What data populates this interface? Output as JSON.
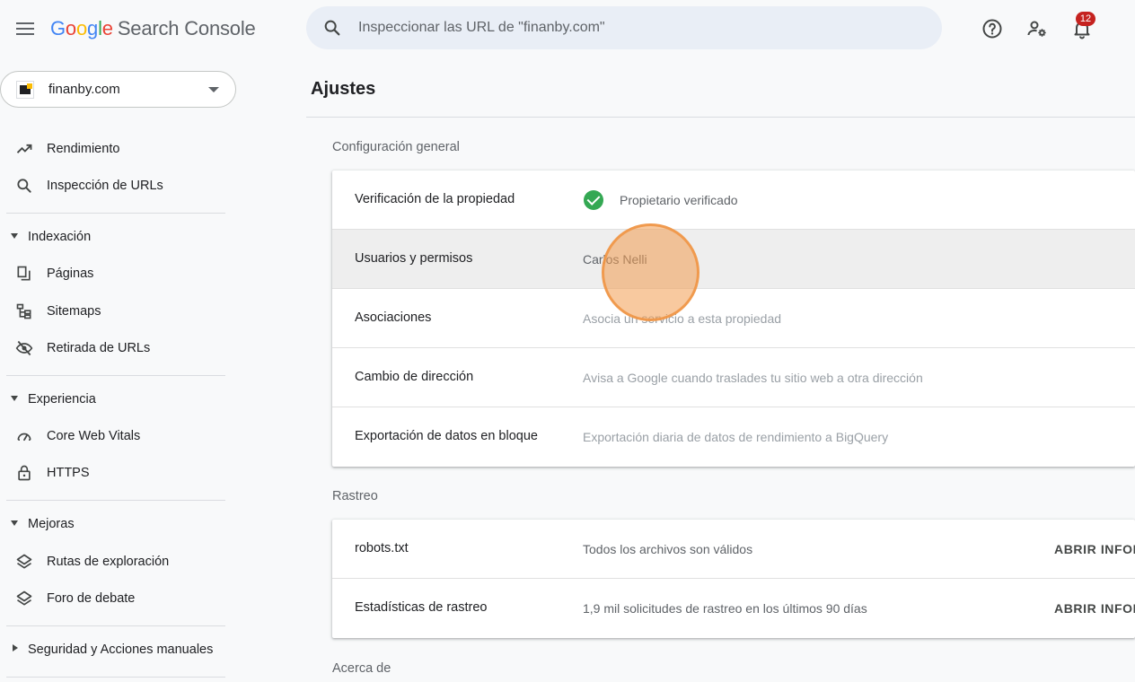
{
  "header": {
    "logo_letters": [
      "G",
      "o",
      "o",
      "g",
      "l",
      "e"
    ],
    "product_name": "Search Console",
    "search_placeholder": "Inspeccionar las URL de \"finanby.com\"",
    "notification_count": "12",
    "icons": [
      "menu-icon",
      "search-icon",
      "help-icon",
      "manage-accounts-icon",
      "notifications-icon"
    ]
  },
  "property": {
    "name": "finanby.com"
  },
  "sidebar": {
    "items": [
      {
        "label": "Rendimiento",
        "icon": "trending-up-icon"
      },
      {
        "label": "Inspección de URLs",
        "icon": "search-icon"
      }
    ],
    "sections": [
      {
        "title": "Indexación",
        "expanded": true,
        "items": [
          {
            "label": "Páginas",
            "icon": "pages-icon"
          },
          {
            "label": "Sitemaps",
            "icon": "sitemap-icon"
          },
          {
            "label": "Retirada de URLs",
            "icon": "visibility-off-icon"
          }
        ]
      },
      {
        "title": "Experiencia",
        "expanded": true,
        "items": [
          {
            "label": "Core Web Vitals",
            "icon": "speed-gauge-icon"
          },
          {
            "label": "HTTPS",
            "icon": "lock-icon"
          }
        ]
      },
      {
        "title": "Mejoras",
        "expanded": true,
        "items": [
          {
            "label": "Rutas de exploración",
            "icon": "layers-icon"
          },
          {
            "label": "Foro de debate",
            "icon": "layers-icon"
          }
        ]
      },
      {
        "title": "Seguridad y Acciones manuales",
        "expanded": false,
        "items": []
      }
    ]
  },
  "main": {
    "title": "Ajustes",
    "general": {
      "heading": "Configuración general",
      "rows": [
        {
          "label": "Verificación de la propiedad",
          "value": "Propietario verificado",
          "status": "verified"
        },
        {
          "label": "Usuarios y permisos",
          "value": "Carlos Nelli",
          "hovered": true
        },
        {
          "label": "Asociaciones",
          "value": "Asocia un servicio a esta propiedad"
        },
        {
          "label": "Cambio de dirección",
          "value": "Avisa a Google cuando traslades tu sitio web a otra dirección"
        },
        {
          "label": "Exportación de datos en bloque",
          "value": "Exportación diaria de datos de rendimiento a BigQuery"
        }
      ]
    },
    "crawl": {
      "heading": "Rastreo",
      "rows": [
        {
          "label": "robots.txt",
          "value": "Todos los archivos son válidos",
          "action": "ABRIR INFORME"
        },
        {
          "label": "Estadísticas de rastreo",
          "value": "1,9 mil solicitudes de rastreo en los últimos 90 días",
          "action": "ABRIR INFORME"
        }
      ]
    },
    "about": {
      "heading": "Acerca de"
    }
  },
  "colors": {
    "accent_blue": "#4285f4",
    "verified_green": "#34a853",
    "badge_red": "#c5221f",
    "click_marker": "#f39c50"
  }
}
